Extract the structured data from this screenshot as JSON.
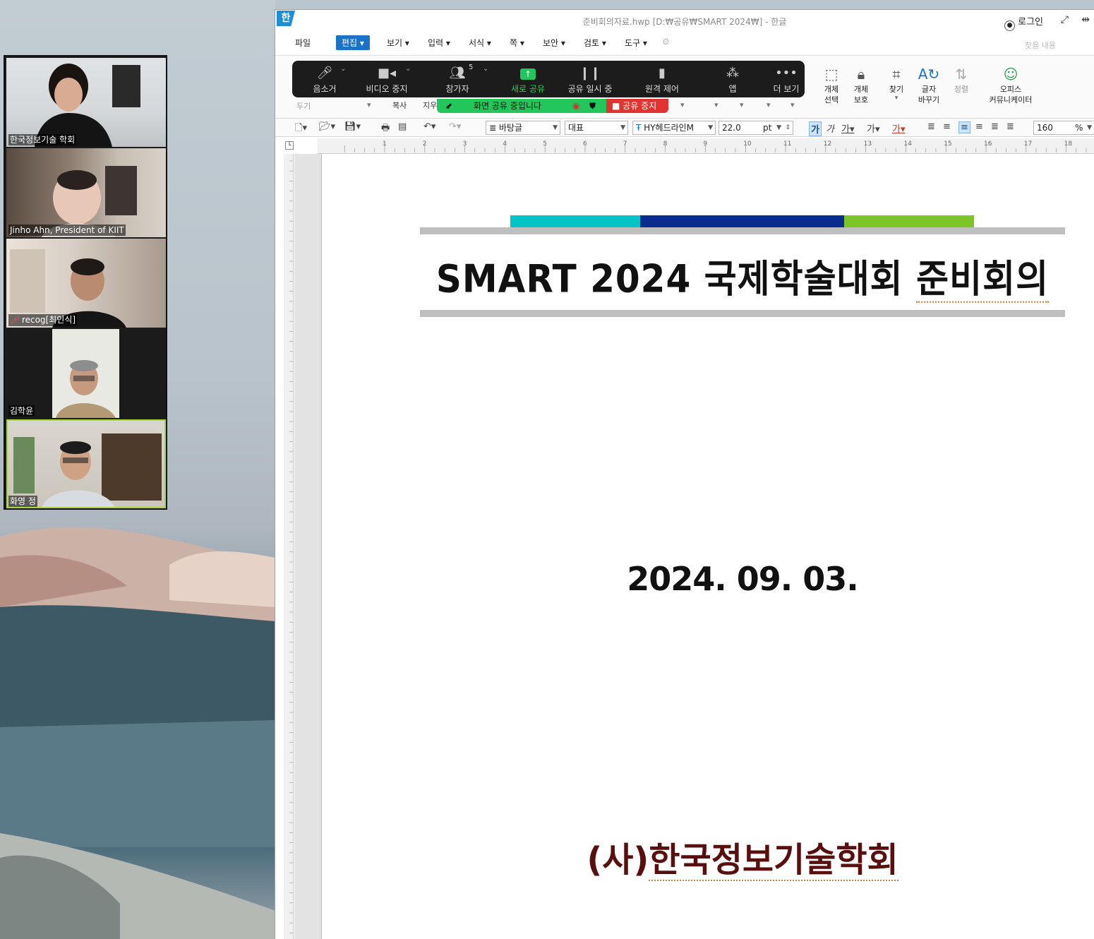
{
  "zoom_gallery": {
    "participants": [
      {
        "name": "한국정보기술 학회"
      },
      {
        "name": "Jinho Ahn, President of KIIT"
      },
      {
        "name": "recog[최인식]",
        "muted": true
      },
      {
        "name": "김학윤"
      },
      {
        "name": "화영 정",
        "active_speaker": true
      }
    ]
  },
  "window": {
    "app_logo": "한",
    "title": "준비회의자료.hwp [D:₩공유₩SMART 2024₩] - 한글",
    "login": "로그인"
  },
  "menu": {
    "items": [
      "파일",
      "편집",
      "보기",
      "입력",
      "서식",
      "쪽",
      "보안",
      "검토",
      "도구"
    ],
    "active": "편집",
    "search_placeholder": "찾을 내용"
  },
  "zoom_toolbar": {
    "buttons": [
      {
        "label": "음소거",
        "icon": "microphone-icon"
      },
      {
        "label": "비디오 중지",
        "icon": "video-camera-icon"
      },
      {
        "label": "참가자",
        "icon": "participants-icon",
        "count": "5"
      },
      {
        "label": "새로 공유",
        "icon": "share-arrow-icon"
      },
      {
        "label": "공유 일시 중",
        "icon": "pause-icon"
      },
      {
        "label": "원격 제어",
        "icon": "mouse-icon"
      },
      {
        "label": "앱",
        "icon": "apps-icon"
      },
      {
        "label": "더 보기",
        "icon": "more-dots-icon"
      }
    ],
    "sharing_status": "화면 공유 중입니다",
    "stop_share": "공유 중지"
  },
  "ribbon": {
    "left_partial": [
      "두기",
      "복사",
      "지우"
    ],
    "tools": [
      {
        "label": "개체\n선택",
        "icon": "select-object-icon"
      },
      {
        "label": "개체\n보호",
        "icon": "protect-object-icon"
      },
      {
        "label": "찾기",
        "icon": "binoculars-icon"
      },
      {
        "label": "글자\n바꾸기",
        "icon": "replace-text-icon"
      },
      {
        "label": "정렬",
        "icon": "sort-icon"
      },
      {
        "label": "오피스\n커뮤니케이터",
        "icon": "office-communicator-icon"
      }
    ]
  },
  "format_bar": {
    "style": "바탕글",
    "lang": "대표",
    "font": "HY헤드라인M",
    "size": "22.0",
    "unit": "pt",
    "zoom": "160",
    "zoom_unit": "%"
  },
  "ruler": {
    "h_marks": [
      "1",
      "2",
      "3",
      "4",
      "5",
      "6",
      "7",
      "8",
      "9",
      "10",
      "11",
      "12",
      "13",
      "14",
      "15",
      "16",
      "17",
      "18"
    ]
  },
  "document": {
    "title_main": "SMART 2024 국제학술대회",
    "title_tail": "준비회의",
    "date": "2024. 09. 03.",
    "org_prefix": "(사)",
    "org_name": "한국정보기술학회",
    "colors": {
      "bar_teal": "#00c4c6",
      "bar_navy": "#0a2c8c",
      "bar_green": "#7dc524",
      "line_gray": "#bfbfbf",
      "org_text": "#5a0f0f"
    }
  }
}
